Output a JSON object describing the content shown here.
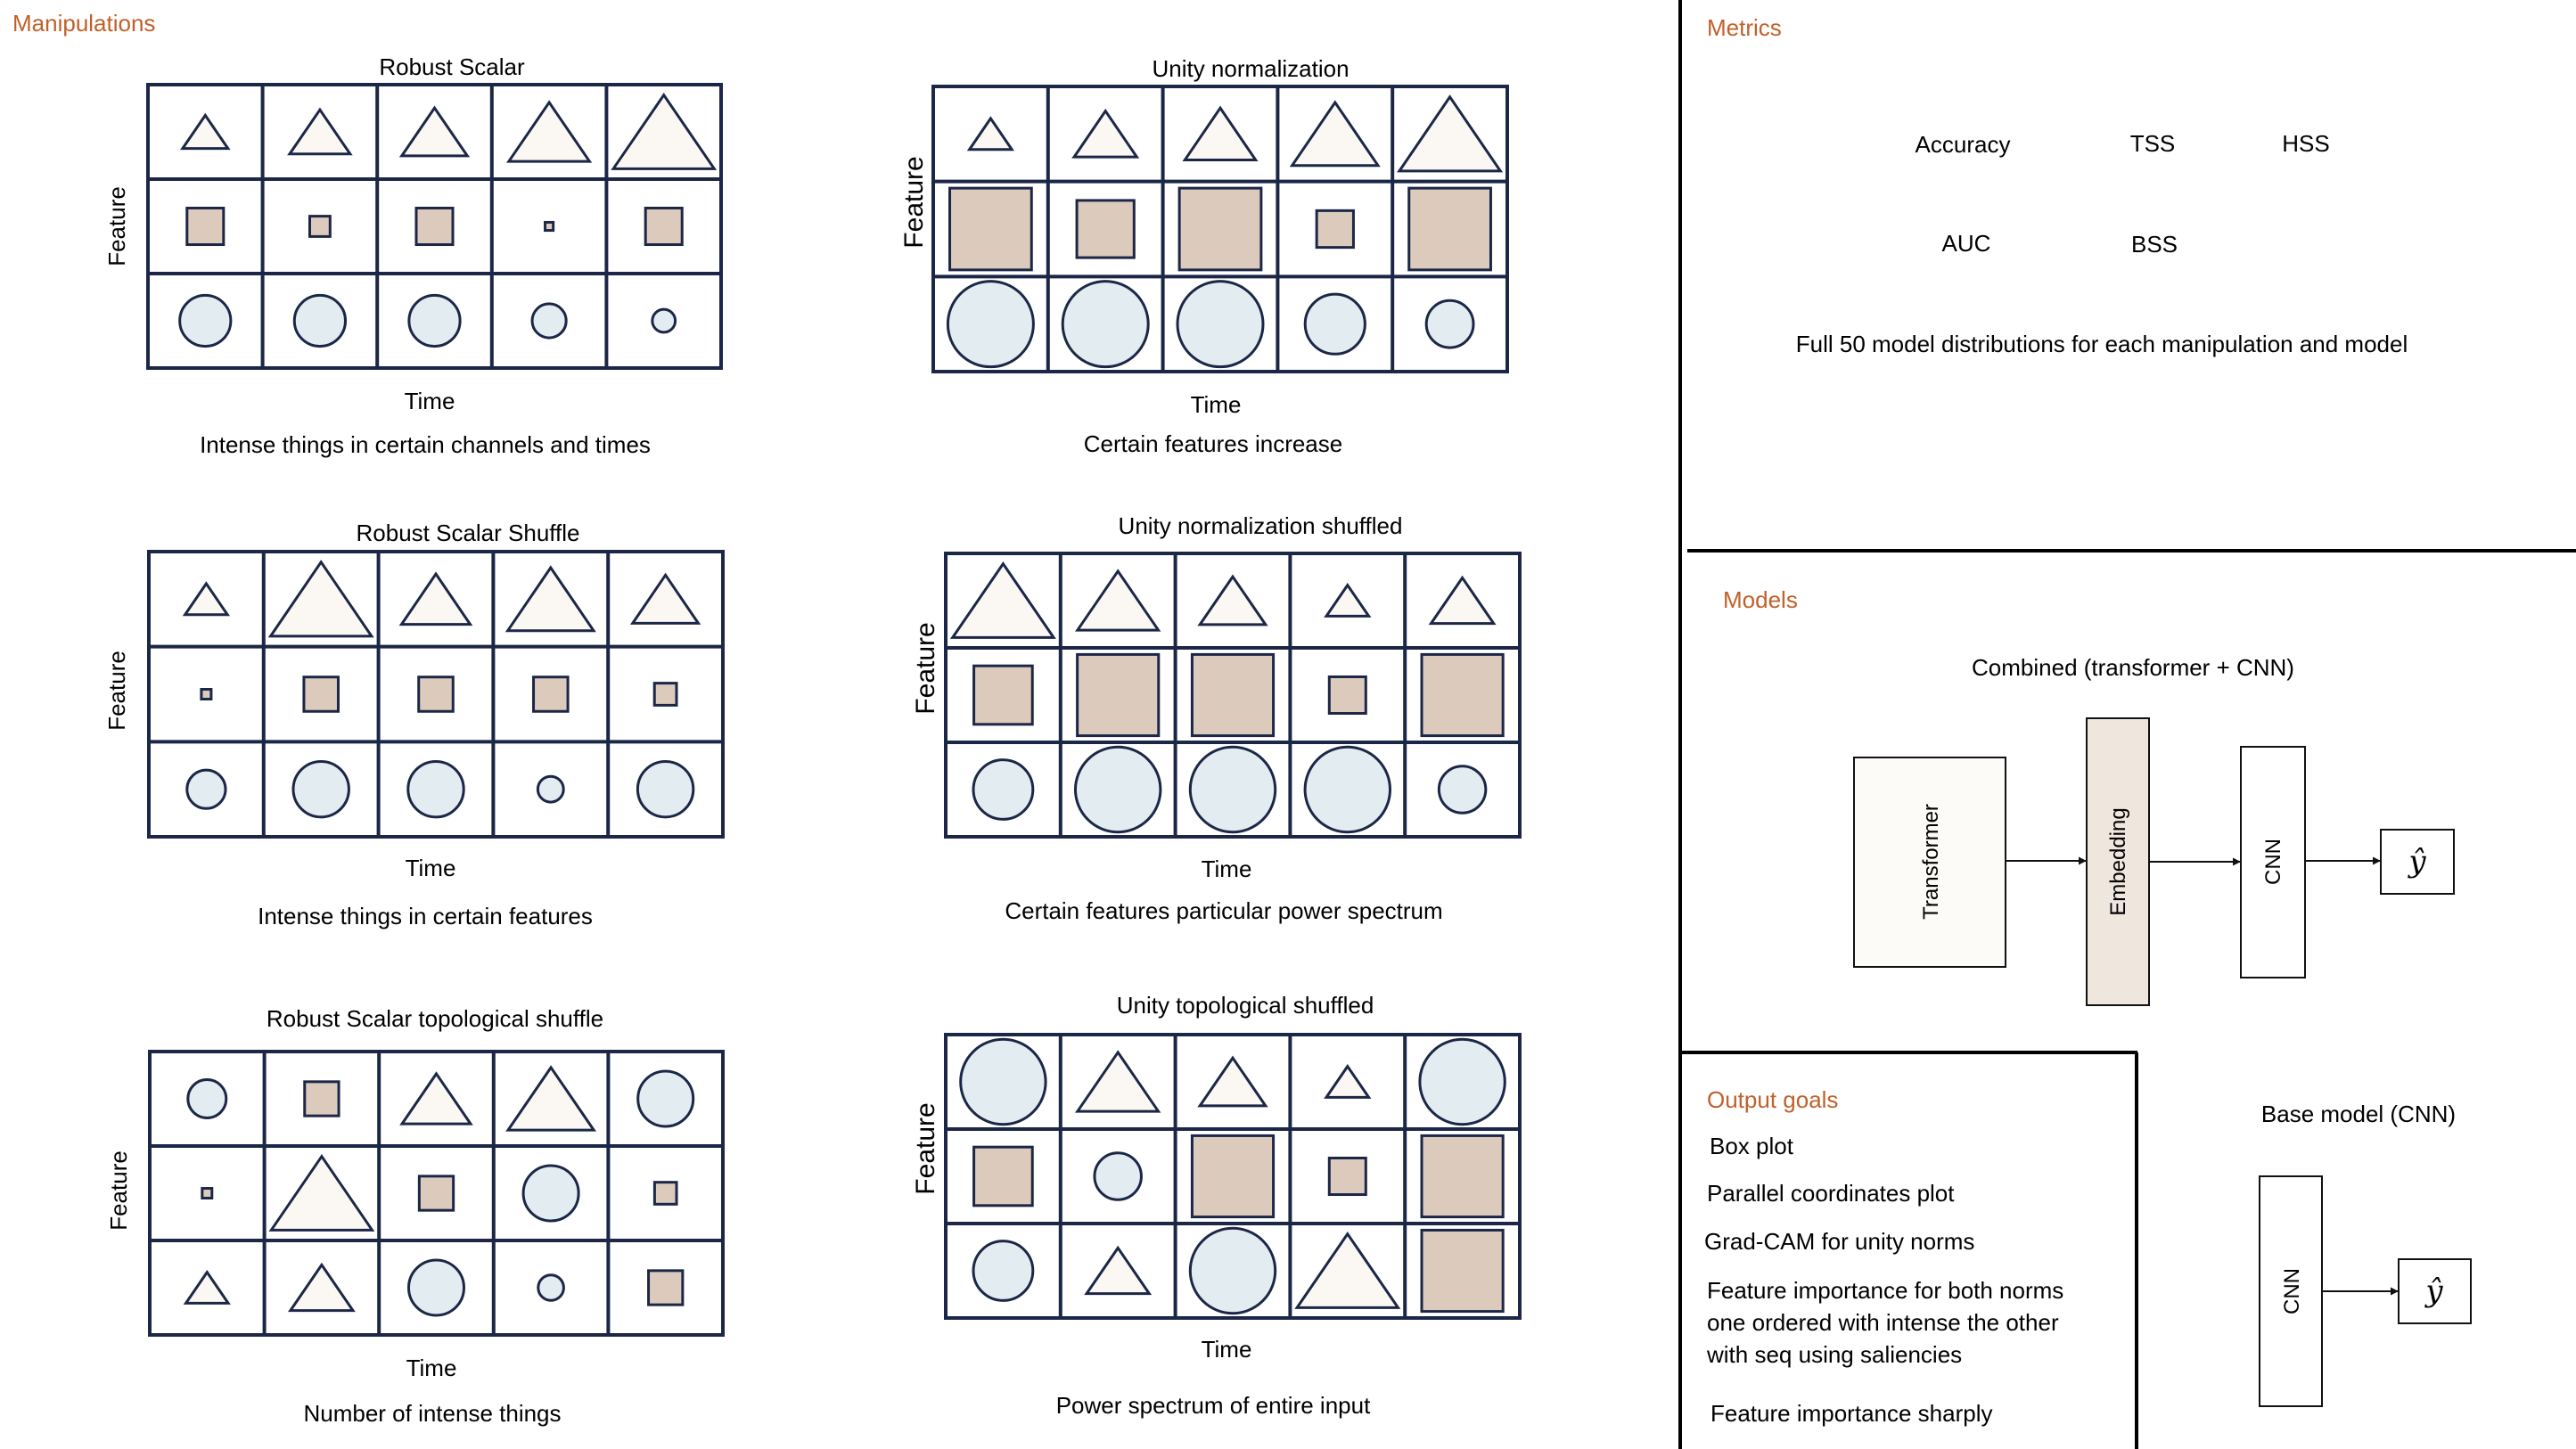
{
  "colors": {
    "accent": "#c0602a",
    "grid_stroke": "#1c2747",
    "triangle_fill": "#fbf8f3",
    "square_fill": "#dccbbd",
    "circle_fill": "#e3ecf0",
    "embedding_fill": "#efe6de",
    "box_fill": "#fdfbf8"
  },
  "manipulations": {
    "heading": "Manipulations",
    "feature_label": "Feature",
    "time_label": "Time",
    "panels": [
      {
        "title": "Robust Scalar",
        "caption": "Intense things in certain channels and times",
        "cells": [
          [
            [
              "t",
              0.45
            ],
            [
              "t",
              0.6
            ],
            [
              "t",
              0.65
            ],
            [
              "t",
              0.8
            ],
            [
              "t",
              1.0
            ]
          ],
          [
            [
              "s",
              0.45
            ],
            [
              "s",
              0.25
            ],
            [
              "s",
              0.45
            ],
            [
              "s",
              0.1
            ],
            [
              "s",
              0.45
            ]
          ],
          [
            [
              "c",
              0.6
            ],
            [
              "c",
              0.6
            ],
            [
              "c",
              0.6
            ],
            [
              "c",
              0.4
            ],
            [
              "c",
              0.27
            ]
          ]
        ]
      },
      {
        "title": "Unity normalization",
        "caption": "Certain features increase",
        "cells": [
          [
            [
              "t",
              0.42
            ],
            [
              "t",
              0.62
            ],
            [
              "t",
              0.7
            ],
            [
              "t",
              0.85
            ],
            [
              "t",
              1.0
            ]
          ],
          [
            [
              "s",
              1.0
            ],
            [
              "s",
              0.7
            ],
            [
              "s",
              1.0
            ],
            [
              "s",
              0.45
            ],
            [
              "s",
              1.0
            ]
          ],
          [
            [
              "c",
              1.0
            ],
            [
              "c",
              1.0
            ],
            [
              "c",
              1.0
            ],
            [
              "c",
              0.7
            ],
            [
              "c",
              0.55
            ]
          ]
        ]
      },
      {
        "title": "Robust Scalar Shuffle",
        "caption": "Intense things in certain features",
        "cells": [
          [
            [
              "t",
              0.42
            ],
            [
              "t",
              1.0
            ],
            [
              "t",
              0.68
            ],
            [
              "t",
              0.85
            ],
            [
              "t",
              0.65
            ]
          ],
          [
            [
              "s",
              0.12
            ],
            [
              "s",
              0.42
            ],
            [
              "s",
              0.42
            ],
            [
              "s",
              0.42
            ],
            [
              "s",
              0.27
            ]
          ],
          [
            [
              "c",
              0.45
            ],
            [
              "c",
              0.65
            ],
            [
              "c",
              0.65
            ],
            [
              "c",
              0.3
            ],
            [
              "c",
              0.65
            ]
          ]
        ]
      },
      {
        "title": "Unity normalization shuffled",
        "caption": "Certain features particular power spectrum",
        "cells": [
          [
            [
              "t",
              1.0
            ],
            [
              "t",
              0.8
            ],
            [
              "t",
              0.65
            ],
            [
              "t",
              0.42
            ],
            [
              "t",
              0.62
            ]
          ],
          [
            [
              "s",
              0.72
            ],
            [
              "s",
              1.0
            ],
            [
              "s",
              1.0
            ],
            [
              "s",
              0.45
            ],
            [
              "s",
              1.0
            ]
          ],
          [
            [
              "c",
              0.7
            ],
            [
              "c",
              1.0
            ],
            [
              "c",
              1.0
            ],
            [
              "c",
              1.0
            ],
            [
              "c",
              0.55
            ]
          ]
        ]
      },
      {
        "title": "Robust Scalar topological shuffle",
        "caption": "Number of intense things",
        "cells": [
          [
            [
              "c",
              0.45
            ],
            [
              "s",
              0.42
            ],
            [
              "t",
              0.68
            ],
            [
              "t",
              0.85
            ],
            [
              "c",
              0.65
            ]
          ],
          [
            [
              "s",
              0.12
            ],
            [
              "t",
              1.0
            ],
            [
              "s",
              0.42
            ],
            [
              "c",
              0.65
            ],
            [
              "s",
              0.27
            ]
          ],
          [
            [
              "t",
              0.42
            ],
            [
              "t",
              0.62
            ],
            [
              "c",
              0.65
            ],
            [
              "c",
              0.3
            ],
            [
              "s",
              0.42
            ]
          ]
        ]
      },
      {
        "title": "Unity topological shuffled",
        "caption": "Power spectrum of entire input",
        "cells": [
          [
            [
              "c",
              1.0
            ],
            [
              "t",
              0.8
            ],
            [
              "t",
              0.65
            ],
            [
              "t",
              0.42
            ],
            [
              "c",
              1.0
            ]
          ],
          [
            [
              "s",
              0.72
            ],
            [
              "c",
              0.55
            ],
            [
              "s",
              1.0
            ],
            [
              "s",
              0.45
            ],
            [
              "s",
              1.0
            ]
          ],
          [
            [
              "c",
              0.7
            ],
            [
              "t",
              0.62
            ],
            [
              "c",
              1.0
            ],
            [
              "t",
              1.0
            ],
            [
              "s",
              1.0
            ]
          ]
        ]
      }
    ]
  },
  "metrics": {
    "heading": "Metrics",
    "items": [
      "Accuracy",
      "TSS",
      "HSS",
      "AUC",
      "BSS"
    ],
    "note": "Full 50 model distributions for each manipulation and model"
  },
  "models": {
    "heading": "Models",
    "combined_title": "Combined (transformer + CNN)",
    "transformer_label": "Transformer",
    "embedding_label": "Embedding",
    "cnn_label": "CNN",
    "output_label": "ŷ",
    "base_title": "Base model (CNN)",
    "base_cnn_label": "CNN",
    "base_output_label": "ŷ"
  },
  "output_goals": {
    "heading": "Output goals",
    "items": [
      [
        "Box plot"
      ],
      [
        "Parallel coordinates plot"
      ],
      [
        "Grad-CAM for unity norms"
      ],
      [
        "Feature importance for both norms",
        "one ordered with intense the other",
        "with seq using saliencies"
      ],
      [
        "Feature importance sharply"
      ]
    ]
  }
}
